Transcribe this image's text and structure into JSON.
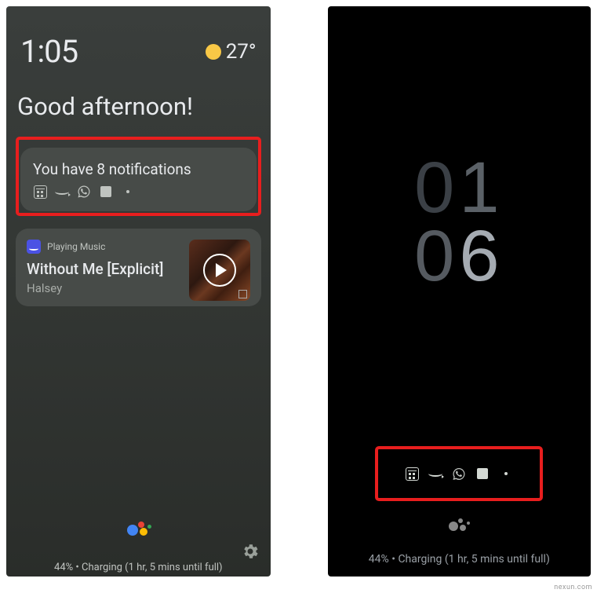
{
  "left_screen": {
    "clock": "1:05",
    "temperature": "27°",
    "greeting": "Good afternoon!",
    "notifications": {
      "title": "You have 8 notifications",
      "icons": [
        "calendar-icon",
        "amazon-icon",
        "whatsapp-icon",
        "square-icon",
        "dot-icon"
      ]
    },
    "music": {
      "provider_label": "Playing Music",
      "song_title": "Without Me [Explicit]",
      "artist": "Halsey"
    },
    "charging_status": "44% • Charging (1 hr, 5 mins until full)"
  },
  "right_screen": {
    "clock_hour_lead": "0",
    "clock_hour": "1",
    "clock_min_lead": "0",
    "clock_min": "6",
    "notification_icons": [
      "calendar-icon",
      "amazon-icon",
      "whatsapp-icon",
      "square-icon",
      "dot-icon"
    ],
    "charging_status": "44% • Charging (1 hr, 5 mins until full)"
  },
  "colors": {
    "highlight_border": "#e81e1e",
    "sun": "#f9c846"
  },
  "watermark": "nexun.com"
}
